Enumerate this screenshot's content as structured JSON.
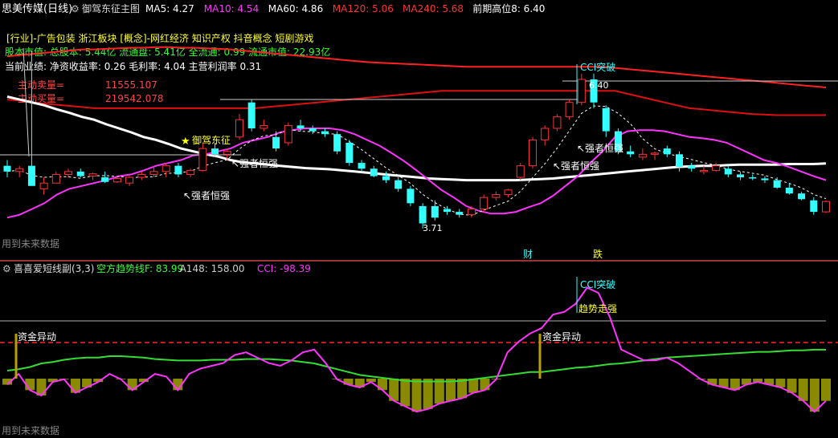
{
  "top_pane": {
    "stock_title": "思美传媒(日线)",
    "indicator_title": "御驾东征主图",
    "ma_items": [
      {
        "label": "MA5: 4.27",
        "color": "#ffffff"
      },
      {
        "label": "MA10: 4.54",
        "color": "#ff33ff"
      },
      {
        "label": "MA60: 4.86",
        "color": "#ffffff"
      },
      {
        "label": "MA120: 5.06",
        "color": "#ff3333"
      },
      {
        "label": "MA240: 5.68",
        "color": "#ff3333"
      },
      {
        "label": "前期高位8: 6.40",
        "color": "#ffffff"
      }
    ],
    "info_lines": [
      {
        "text": "[行业]-广告包装 浙江板块 [概念]-网红经济 知识产权 抖音概念 短剧游戏",
        "color": "#ffff33"
      },
      {
        "text": "股本市值: 总股本: 5.44亿 流通盘: 5.41亿 全流通: 0.99 流通市值: 22.93亿",
        "color": "#33ff33"
      },
      {
        "text": "当前业绩: 净资收益率: 0.26 毛利率: 4.04 主营利润率 0.31",
        "color": "#ffffff"
      }
    ],
    "sell_label": "主动卖量=",
    "sell_value": "11555.107",
    "buy_label": "主动买量=",
    "buy_value": "219542.078",
    "footer": "用到未来数据",
    "annotations": {
      "cci_break": "CCI突破",
      "high_price": "6.40",
      "low_price": "3.71",
      "star_label": "御驾东征",
      "strong1": "↖强者恒强",
      "strong2": "↖强者恒强",
      "strong3": "↖强者恒强",
      "strong4": "↖强者恒强",
      "cai": "财",
      "die": "跌"
    }
  },
  "bottom_pane": {
    "title": "喜喜爱短线副(3,3)",
    "items": [
      {
        "label": "空方趋势线F: 83.99",
        "color": "#33ff33"
      },
      {
        "label": "A148: 158.00",
        "color": "#cccccc"
      },
      {
        "label": "CCI: -98.39",
        "color": "#ff33ff"
      }
    ],
    "annotations": {
      "cci_break": "CCI突破",
      "trend_strong": "趋势走强",
      "fund1": "资金异动",
      "fund2": "资金异动"
    },
    "footer": "用到未来数据"
  },
  "colors": {
    "up": "#ff3333",
    "down": "#33ffff",
    "ma5": "#ffffff",
    "ma10": "#ff33ff",
    "ma60": "#ffffff",
    "ma120": "#ff2222",
    "cci": "#ff33ff",
    "trend": "#33dd33",
    "hist": "#8a8a00"
  },
  "chart_data": [
    {
      "type": "candlestick",
      "title": "思美传媒(日线) 御驾东征主图",
      "y_range": [
        3.5,
        7.4
      ],
      "candles": [
        {
          "o": 4.8,
          "h": 4.9,
          "l": 4.6,
          "c": 4.7
        },
        {
          "o": 4.7,
          "h": 4.8,
          "l": 4.6,
          "c": 4.75
        },
        {
          "o": 4.8,
          "h": 6.8,
          "l": 4.7,
          "c": 4.45
        },
        {
          "o": 4.4,
          "h": 4.6,
          "l": 4.3,
          "c": 4.5
        },
        {
          "o": 4.5,
          "h": 4.7,
          "l": 4.5,
          "c": 4.65
        },
        {
          "o": 4.65,
          "h": 4.75,
          "l": 4.6,
          "c": 4.7
        },
        {
          "o": 4.7,
          "h": 4.75,
          "l": 4.6,
          "c": 4.62
        },
        {
          "o": 4.62,
          "h": 4.68,
          "l": 4.55,
          "c": 4.66
        },
        {
          "o": 4.6,
          "h": 4.7,
          "l": 4.5,
          "c": 4.52
        },
        {
          "o": 4.52,
          "h": 4.62,
          "l": 4.5,
          "c": 4.58
        },
        {
          "o": 4.5,
          "h": 4.62,
          "l": 4.45,
          "c": 4.6
        },
        {
          "o": 4.6,
          "h": 4.7,
          "l": 4.55,
          "c": 4.65
        },
        {
          "o": 4.65,
          "h": 4.8,
          "l": 4.6,
          "c": 4.7
        },
        {
          "o": 4.7,
          "h": 4.85,
          "l": 4.6,
          "c": 4.8
        },
        {
          "o": 4.8,
          "h": 4.85,
          "l": 4.6,
          "c": 4.65
        },
        {
          "o": 4.65,
          "h": 4.75,
          "l": 4.6,
          "c": 4.72
        },
        {
          "o": 4.72,
          "h": 5.2,
          "l": 4.7,
          "c": 5.1
        },
        {
          "o": 5.1,
          "h": 5.2,
          "l": 4.95,
          "c": 5.0
        },
        {
          "o": 5.0,
          "h": 5.1,
          "l": 4.9,
          "c": 5.05
        },
        {
          "o": 5.3,
          "h": 5.7,
          "l": 5.25,
          "c": 5.6
        },
        {
          "o": 5.9,
          "h": 5.95,
          "l": 5.4,
          "c": 5.45
        },
        {
          "o": 5.45,
          "h": 5.6,
          "l": 5.4,
          "c": 5.5
        },
        {
          "o": 5.3,
          "h": 5.4,
          "l": 5.05,
          "c": 5.1
        },
        {
          "o": 5.2,
          "h": 5.55,
          "l": 5.15,
          "c": 5.5
        },
        {
          "o": 5.5,
          "h": 5.6,
          "l": 5.4,
          "c": 5.45
        },
        {
          "o": 5.45,
          "h": 5.5,
          "l": 5.35,
          "c": 5.4
        },
        {
          "o": 5.4,
          "h": 5.45,
          "l": 5.3,
          "c": 5.35
        },
        {
          "o": 5.35,
          "h": 5.4,
          "l": 5.0,
          "c": 5.05
        },
        {
          "o": 5.2,
          "h": 5.25,
          "l": 4.8,
          "c": 4.85
        },
        {
          "o": 4.85,
          "h": 4.9,
          "l": 4.7,
          "c": 4.75
        },
        {
          "o": 4.75,
          "h": 4.8,
          "l": 4.6,
          "c": 4.62
        },
        {
          "o": 4.62,
          "h": 4.7,
          "l": 4.5,
          "c": 4.55
        },
        {
          "o": 4.55,
          "h": 4.6,
          "l": 4.35,
          "c": 4.4
        },
        {
          "o": 4.4,
          "h": 4.45,
          "l": 4.1,
          "c": 4.15
        },
        {
          "o": 4.1,
          "h": 4.15,
          "l": 3.71,
          "c": 3.8
        },
        {
          "o": 4.1,
          "h": 4.2,
          "l": 3.85,
          "c": 3.9
        },
        {
          "o": 4.05,
          "h": 4.1,
          "l": 3.95,
          "c": 4.0
        },
        {
          "o": 4.0,
          "h": 4.05,
          "l": 3.9,
          "c": 3.95
        },
        {
          "o": 3.95,
          "h": 4.1,
          "l": 3.9,
          "c": 4.05
        },
        {
          "o": 4.05,
          "h": 4.3,
          "l": 4.0,
          "c": 4.25
        },
        {
          "o": 4.25,
          "h": 4.35,
          "l": 4.2,
          "c": 4.3
        },
        {
          "o": 4.3,
          "h": 4.4,
          "l": 4.25,
          "c": 4.38
        },
        {
          "o": 4.6,
          "h": 4.85,
          "l": 4.55,
          "c": 4.8
        },
        {
          "o": 4.8,
          "h": 5.3,
          "l": 4.75,
          "c": 5.25
        },
        {
          "o": 5.25,
          "h": 5.5,
          "l": 5.15,
          "c": 5.45
        },
        {
          "o": 5.45,
          "h": 5.7,
          "l": 5.4,
          "c": 5.65
        },
        {
          "o": 5.65,
          "h": 5.95,
          "l": 5.6,
          "c": 5.9
        },
        {
          "o": 5.9,
          "h": 6.4,
          "l": 5.85,
          "c": 6.3
        },
        {
          "o": 6.3,
          "h": 6.4,
          "l": 5.8,
          "c": 5.9
        },
        {
          "o": 5.8,
          "h": 5.85,
          "l": 5.3,
          "c": 5.4
        },
        {
          "o": 5.4,
          "h": 5.45,
          "l": 5.0,
          "c": 5.05
        },
        {
          "o": 5.05,
          "h": 5.15,
          "l": 4.95,
          "c": 5.0
        },
        {
          "o": 4.95,
          "h": 5.1,
          "l": 4.9,
          "c": 5.0
        },
        {
          "o": 5.0,
          "h": 5.05,
          "l": 4.9,
          "c": 5.02
        },
        {
          "o": 5.1,
          "h": 5.15,
          "l": 4.95,
          "c": 5.0
        },
        {
          "o": 5.0,
          "h": 5.05,
          "l": 4.7,
          "c": 4.78
        },
        {
          "o": 4.8,
          "h": 4.85,
          "l": 4.7,
          "c": 4.75
        },
        {
          "o": 4.7,
          "h": 4.8,
          "l": 4.65,
          "c": 4.72
        },
        {
          "o": 4.72,
          "h": 4.85,
          "l": 4.7,
          "c": 4.8
        },
        {
          "o": 4.75,
          "h": 4.8,
          "l": 4.6,
          "c": 4.65
        },
        {
          "o": 4.65,
          "h": 4.7,
          "l": 4.55,
          "c": 4.6
        },
        {
          "o": 4.6,
          "h": 4.65,
          "l": 4.55,
          "c": 4.58
        },
        {
          "o": 4.58,
          "h": 4.62,
          "l": 4.5,
          "c": 4.55
        },
        {
          "o": 4.55,
          "h": 4.6,
          "l": 4.4,
          "c": 4.42
        },
        {
          "o": 4.42,
          "h": 4.5,
          "l": 4.3,
          "c": 4.32
        },
        {
          "o": 4.32,
          "h": 4.35,
          "l": 4.2,
          "c": 4.22
        },
        {
          "o": 4.2,
          "h": 4.25,
          "l": 3.95,
          "c": 4.0
        },
        {
          "o": 4.0,
          "h": 4.2,
          "l": 3.98,
          "c": 4.18
        }
      ],
      "series": [
        {
          "name": "MA10",
          "values": [
            3.9,
            3.95,
            4.05,
            4.15,
            4.3,
            4.4,
            4.45,
            4.5,
            4.55,
            4.62,
            4.65,
            4.72,
            4.8,
            4.85,
            4.9,
            4.98,
            5.0,
            5.05,
            5.1,
            5.2,
            5.25,
            5.3,
            5.38,
            5.42,
            5.45,
            5.45,
            5.45,
            5.42,
            5.35,
            5.25,
            5.15,
            5.02,
            4.88,
            4.72,
            4.55,
            4.38,
            4.25,
            4.1,
            4.02,
            3.97,
            3.97,
            4.0,
            4.08,
            4.15,
            4.28,
            4.45,
            4.62,
            4.85,
            5.05,
            5.3,
            5.4,
            5.42,
            5.42,
            5.4,
            5.35,
            5.3,
            5.28,
            5.25,
            5.2,
            5.1,
            5.0,
            4.9,
            4.85,
            4.78,
            4.7,
            4.62,
            4.55
          ]
        },
        {
          "name": "MA60",
          "values": [
            6.0,
            5.95,
            5.9,
            5.85,
            5.78,
            5.72,
            5.65,
            5.6,
            5.52,
            5.45,
            5.38,
            5.3,
            5.25,
            5.18,
            5.1,
            5.05,
            5.0,
            4.96,
            4.9,
            4.86,
            4.84,
            4.82,
            4.8,
            4.78,
            4.76,
            4.75,
            4.74,
            4.72,
            4.7,
            4.68,
            4.66,
            4.64,
            4.62,
            4.6,
            4.58,
            4.57,
            4.56,
            4.55,
            4.55,
            4.55,
            4.55,
            4.55,
            4.56,
            4.57,
            4.58,
            4.6,
            4.62,
            4.64,
            4.66,
            4.68,
            4.7,
            4.72,
            4.74,
            4.76,
            4.78,
            4.79,
            4.8,
            4.8,
            4.81,
            4.82,
            4.82,
            4.82,
            4.82,
            4.83,
            4.83,
            4.83,
            4.84
          ]
        },
        {
          "name": "MA120",
          "values": [
            6.7,
            6.72,
            6.74,
            6.76,
            6.78,
            6.8,
            6.82,
            6.82,
            6.83,
            6.84,
            6.85,
            6.85,
            6.86,
            6.86,
            6.85,
            6.85,
            6.84,
            6.83,
            6.82,
            6.8,
            6.78,
            6.76,
            6.74,
            6.72,
            6.7,
            6.68,
            6.66,
            6.64,
            6.62,
            6.6,
            6.59,
            6.58,
            6.57,
            6.56,
            6.55,
            6.54,
            6.53,
            6.52,
            6.52,
            6.52,
            6.52,
            6.52,
            6.52,
            6.52,
            6.52,
            6.52,
            6.52,
            6.52,
            6.52,
            6.5,
            6.48,
            6.46,
            6.44,
            6.42,
            6.4,
            6.38,
            6.36,
            6.34,
            6.32,
            6.3,
            6.28,
            6.26,
            6.24,
            6.22,
            6.2,
            6.18,
            6.16
          ]
        },
        {
          "name": "MA240",
          "values": [
            5.95,
            5.93,
            5.9,
            5.88,
            5.86,
            5.84,
            5.82,
            5.8,
            5.8,
            5.8,
            5.8,
            5.8,
            5.8,
            5.8,
            5.8,
            5.8,
            5.8,
            5.8,
            5.8,
            5.8,
            5.8,
            5.82,
            5.84,
            5.86,
            5.88,
            5.9,
            5.92,
            5.94,
            5.96,
            5.98,
            6.0,
            6.02,
            6.04,
            6.06,
            6.08,
            6.1,
            6.1,
            6.1,
            6.1,
            6.1,
            6.1,
            6.1,
            6.1,
            6.1,
            6.1,
            6.1,
            6.1,
            6.1,
            6.1,
            6.1,
            6.05,
            6.0,
            5.95,
            5.9,
            5.85,
            5.8,
            5.78,
            5.76,
            5.74,
            5.72,
            5.7,
            5.69,
            5.68,
            5.68,
            5.68,
            5.68,
            5.68
          ]
        }
      ]
    },
    {
      "type": "line",
      "title": "喜喜爱短线副(3,3)",
      "y_range": [
        -250,
        300
      ],
      "series": [
        {
          "name": "CCI",
          "values": [
            -100,
            -60,
            -120,
            -140,
            -90,
            -80,
            -130,
            -110,
            -90,
            -60,
            -80,
            -120,
            -90,
            -60,
            -70,
            -120,
            -60,
            -40,
            -30,
            -20,
            10,
            20,
            0,
            -20,
            -30,
            -10,
            20,
            30,
            -20,
            -80,
            -100,
            -110,
            -90,
            -120,
            -160,
            -180,
            -200,
            -190,
            -170,
            -160,
            -150,
            -130,
            -120,
            -80,
            20,
            60,
            90,
            110,
            160,
            170,
            200,
            260,
            240,
            150,
            30,
            10,
            -10,
            -10,
            0,
            -20,
            -50,
            -80,
            -100,
            -110,
            -120,
            -100,
            -90,
            -100,
            -110,
            -130,
            -160,
            -200,
            -160
          ]
        },
        {
          "name": "空方趋势线F",
          "values": [
            0,
            2,
            5,
            10,
            12,
            15,
            17,
            18,
            18,
            20,
            20,
            19,
            18,
            16,
            15,
            14,
            14,
            14,
            15,
            15,
            15,
            16,
            16,
            16,
            15,
            14,
            12,
            10,
            6,
            2,
            -2,
            -6,
            -8,
            -10,
            -12,
            -14,
            -15,
            -15,
            -15,
            -15,
            -14,
            -12,
            -10,
            -8,
            -6,
            -4,
            -2,
            -2,
            0,
            2,
            4,
            5,
            7,
            9,
            10,
            12,
            14,
            16,
            18,
            19,
            20,
            21,
            22,
            23,
            24,
            25,
            26,
            26,
            27,
            28,
            28,
            29,
            29
          ]
        },
        {
          "name": "A148",
          "values": [
            158,
            158,
            158,
            158,
            158,
            158,
            158,
            158,
            158,
            158,
            158,
            158,
            158,
            158,
            158,
            158,
            158,
            158,
            158,
            158,
            158,
            158,
            158,
            158,
            158,
            158,
            158,
            158,
            158,
            158,
            158,
            158,
            158,
            158,
            158,
            158,
            158,
            158,
            158,
            158,
            158,
            158,
            158,
            158,
            158,
            158,
            158,
            158,
            158,
            158,
            158,
            158,
            158,
            158,
            158,
            158,
            158,
            158,
            158,
            158,
            158,
            158,
            158,
            158,
            158,
            158,
            158,
            158,
            158,
            158,
            158,
            158,
            158
          ]
        }
      ]
    }
  ]
}
